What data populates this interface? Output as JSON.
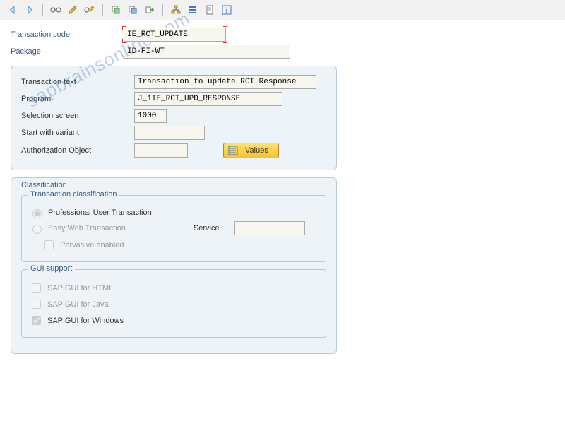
{
  "header": {
    "labels": {
      "tcode": "Transaction code",
      "package": "Package"
    },
    "tcode_value": "IE_RCT_UPDATE",
    "package_value": "ID-FI-WT"
  },
  "details": {
    "labels": {
      "ttext": "Transaction text",
      "program": "Program",
      "selscreen": "Selection screen",
      "startvar": "Start with variant",
      "authobj": "Authorization Object"
    },
    "ttext_value": "Transaction to update RCT Response",
    "program_value": "J_1IE_RCT_UPD_RESPONSE",
    "selscreen_value": "1000",
    "startvar_value": "",
    "authobj_value": "",
    "values_btn": "Values"
  },
  "classification": {
    "title": "Classification",
    "group_title": "Transaction classification",
    "professional": "Professional User Transaction",
    "easyweb": "Easy Web Transaction",
    "service": "Service",
    "pervasive": "Pervasive enabled",
    "gui_title": "GUI support",
    "gui_html": "SAP GUI for HTML",
    "gui_java": "SAP GUI for Java",
    "gui_win": "SAP GUI for Windows"
  },
  "watermark": "sapbrainsonline.com"
}
